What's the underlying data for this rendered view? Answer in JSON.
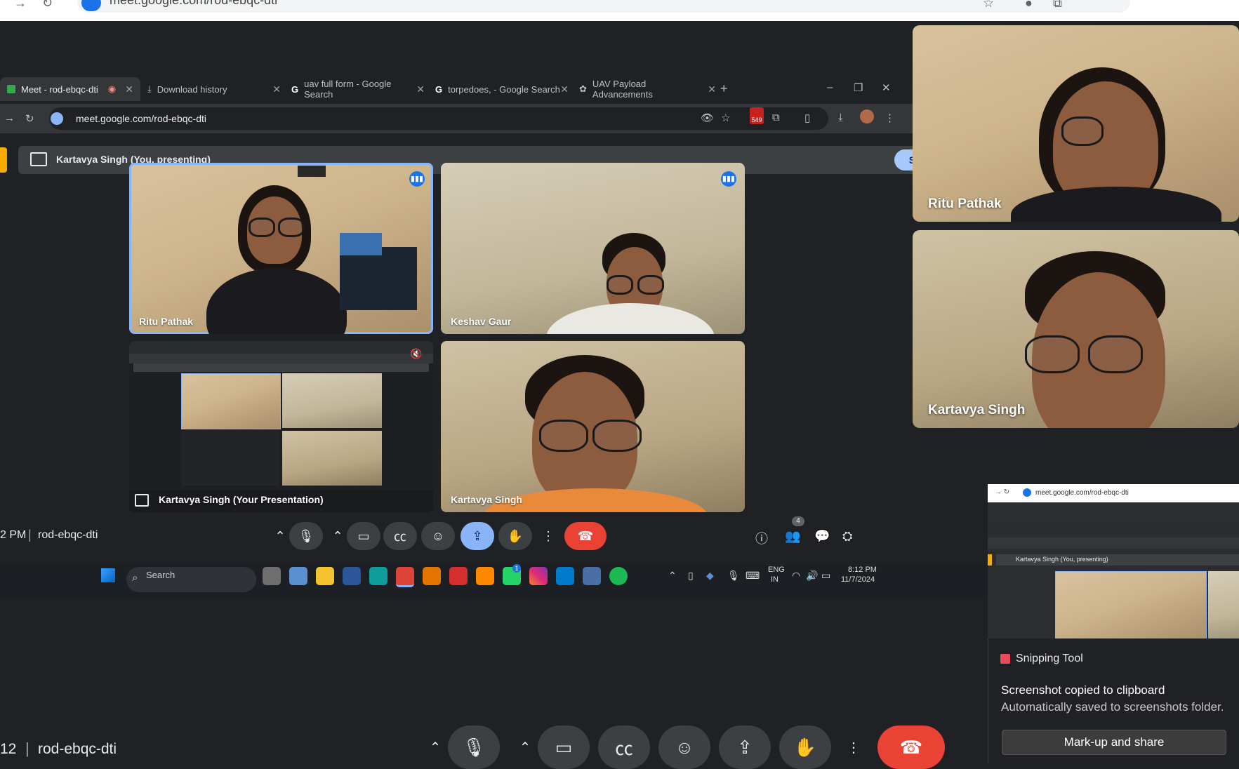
{
  "outer_browser": {
    "url": "meet.google.com/rod-ebqc-dti"
  },
  "inner_browser": {
    "tabs": [
      {
        "label": "Meet - rod-ebqc-dti",
        "active": true
      },
      {
        "label": "Download history",
        "active": false
      },
      {
        "label": "uav full form - Google Search",
        "active": false
      },
      {
        "label": "torpedoes, - Google Search",
        "active": false
      },
      {
        "label": "UAV Payload Advancements",
        "active": false
      }
    ],
    "new_tab": "+",
    "window_controls": {
      "minimize": "–",
      "restore": "❐",
      "close": "✕"
    },
    "url": "meet.google.com/rod-ebqc-dti",
    "extension_badge": "549"
  },
  "presenting_bar": {
    "text": "Kartavya Singh (You, presenting)",
    "stop_label": "Stop presenting"
  },
  "tiles": [
    {
      "name": "Ritu Pathak"
    },
    {
      "name": "Keshav Gaur"
    },
    {
      "name": "Kartavya Singh (Your Presentation)"
    },
    {
      "name": "Kartavya Singh"
    }
  ],
  "meeting_footer": {
    "time": "2 PM",
    "code": "rod-ebqc-dti",
    "participants_badge": "4"
  },
  "taskbar": {
    "search_placeholder": "Search",
    "lang_top": "ENG",
    "lang_bottom": "IN",
    "time": "8:12 PM",
    "date": "11/7/2024",
    "whatsapp_badge": "1"
  },
  "side_tiles": [
    {
      "name": "Ritu Pathak"
    },
    {
      "name": "Kartavya Singh"
    }
  ],
  "snip_preview": {
    "url": "meet.google.com/rod-ebqc-dti",
    "presenting": "Kartavya Singh (You, presenting)"
  },
  "notification": {
    "app": "Snipping Tool",
    "line1": "Screenshot copied to clipboard",
    "line2": "Automatically saved to screenshots folder.",
    "button": "Mark-up and share"
  },
  "bottom_footer": {
    "time": "12",
    "code": "rod-ebqc-dti"
  }
}
